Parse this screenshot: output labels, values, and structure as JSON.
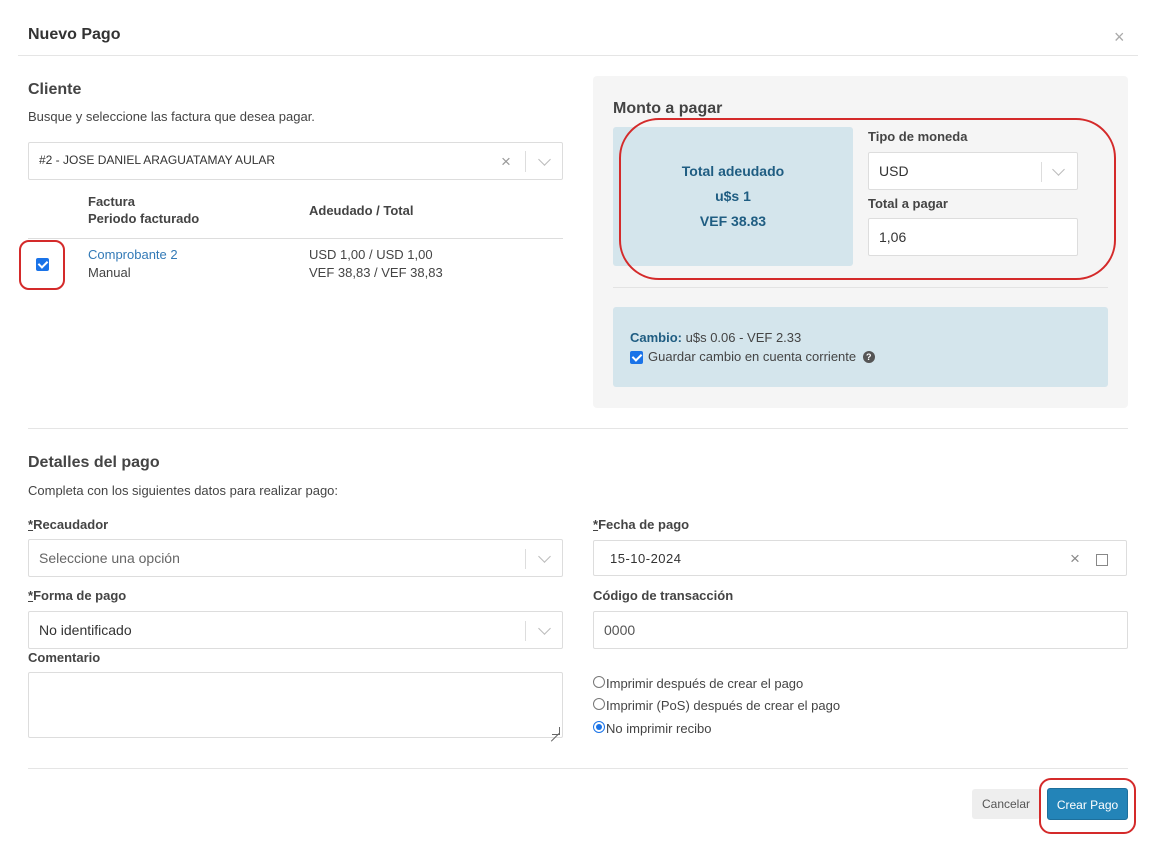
{
  "modal": {
    "title": "Nuevo Pago",
    "close": "×"
  },
  "cliente": {
    "title": "Cliente",
    "help": "Busque y seleccione las factura que desea pagar.",
    "selected_client": "#2 - JOSE DANIEL ARAGUATAMAY AULAR",
    "clear": "×",
    "table": {
      "col1_line1": "Factura",
      "col1_line2": "Periodo facturado",
      "col2": "Adeudado / Total",
      "rows": [
        {
          "checked": true,
          "invoice": "Comprobante 2",
          "period": "Manual",
          "amount_line1": "USD 1,00 / USD 1,00",
          "amount_line2": "VEF 38,83 / VEF 38,83"
        }
      ]
    }
  },
  "monto": {
    "title": "Monto a pagar",
    "total_label": "Total adeudado",
    "total_usd": "u$s 1",
    "total_vef": "VEF 38.83",
    "currency_label": "Tipo de moneda",
    "currency_value": "USD",
    "total_pay_label": "Total a pagar",
    "total_pay_value": "1,06",
    "cambio_label": "Cambio:",
    "cambio_value": "u$s 0.06 - VEF 2.33",
    "save_change_label": "Guardar cambio en cuenta corriente",
    "save_change_checked": true,
    "help_icon": "?"
  },
  "detalles": {
    "title": "Detalles del pago",
    "help": "Completa con los siguientes datos para realizar pago:",
    "required_mark": "*",
    "recaudador_label": "Recaudador",
    "recaudador_placeholder": "Seleccione una opción",
    "fecha_label": "Fecha de pago",
    "fecha_value": "15-10-2024",
    "forma_label": "Forma de pago",
    "forma_value": "No identificado",
    "codigo_label": "Código de transacción",
    "codigo_value": "0000",
    "comentario_label": "Comentario",
    "print_options": [
      {
        "label": "Imprimir después de crear el pago",
        "selected": false
      },
      {
        "label": "Imprimir (PoS) después de crear el pago",
        "selected": false
      },
      {
        "label": "No imprimir recibo",
        "selected": true
      }
    ]
  },
  "footer": {
    "cancel": "Cancelar",
    "submit": "Crear Pago"
  },
  "colors": {
    "primary": "#2384b8",
    "highlight": "#d42a2a",
    "info_bg": "#d4e5ec",
    "link": "#337ab7"
  },
  "icons": [
    "close-icon",
    "chevron-down-icon",
    "calendar-icon",
    "help-icon",
    "checkbox-icon",
    "radio-icon"
  ]
}
